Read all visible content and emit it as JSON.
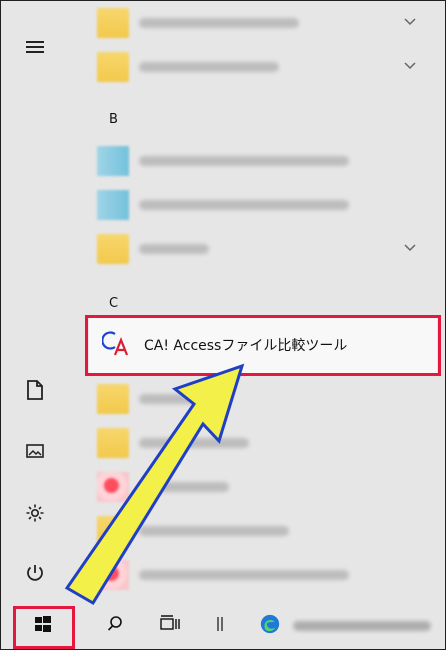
{
  "menu": {
    "letters": [
      "B",
      "C"
    ],
    "app_label": "CA! Accessファイル比較ツール"
  },
  "icons": {
    "hamburger": "hamburger-icon",
    "documents": "document-icon",
    "pictures": "picture-icon",
    "settings": "gear-icon",
    "power": "power-icon",
    "start": "windows-start-icon",
    "search": "search-icon",
    "task_view": "task-view-icon",
    "divider": "taskbar-divider-icon",
    "edge": "edge-icon",
    "app_logo": "ca-logo-icon"
  },
  "colors": {
    "highlight": "#e6173f",
    "arrow_fill": "#f3f04a",
    "arrow_stroke": "#1f3fc5"
  }
}
